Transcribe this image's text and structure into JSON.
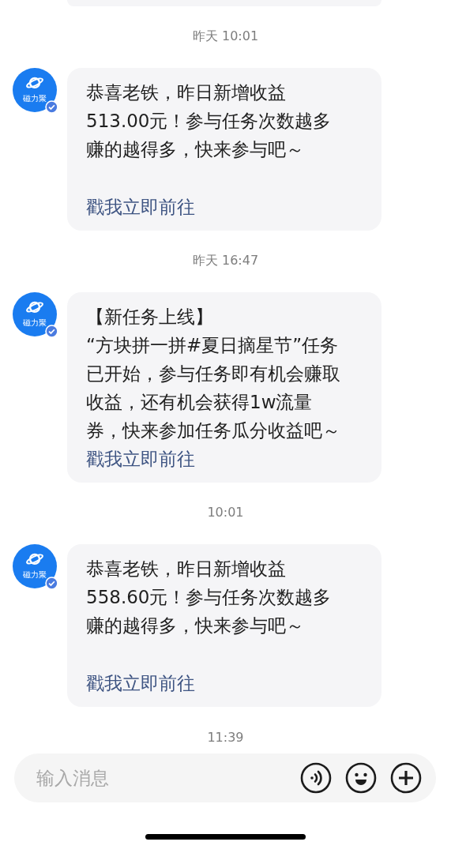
{
  "messages": [
    {
      "time": "昨天 10:01",
      "avatar_label": "磁力聚",
      "lines": [
        "恭喜老铁，昨日新增收益",
        "513.00元！参与任务次数越多",
        "赚的越得多，快来参与吧～"
      ],
      "link": "戳我立即前往"
    },
    {
      "time": "昨天 16:47",
      "avatar_label": "磁力聚",
      "lines": [
        "【新任务上线】",
        "“方块拼一拼#夏日摘星节”任务",
        "已开始，参与任务即有机会赚取",
        "收益，还有机会获得1w流量",
        "券，快来参加任务瓜分收益吧～"
      ],
      "link": "戳我立即前往"
    },
    {
      "time": "10:01",
      "avatar_label": "磁力聚",
      "lines": [
        "恭喜老铁，昨日新增收益",
        "558.60元！参与任务次数越多",
        "赚的越得多，快来参与吧～"
      ],
      "link": "戳我立即前往"
    }
  ],
  "last_time": "11:39",
  "composer": {
    "placeholder": "输入消息"
  }
}
